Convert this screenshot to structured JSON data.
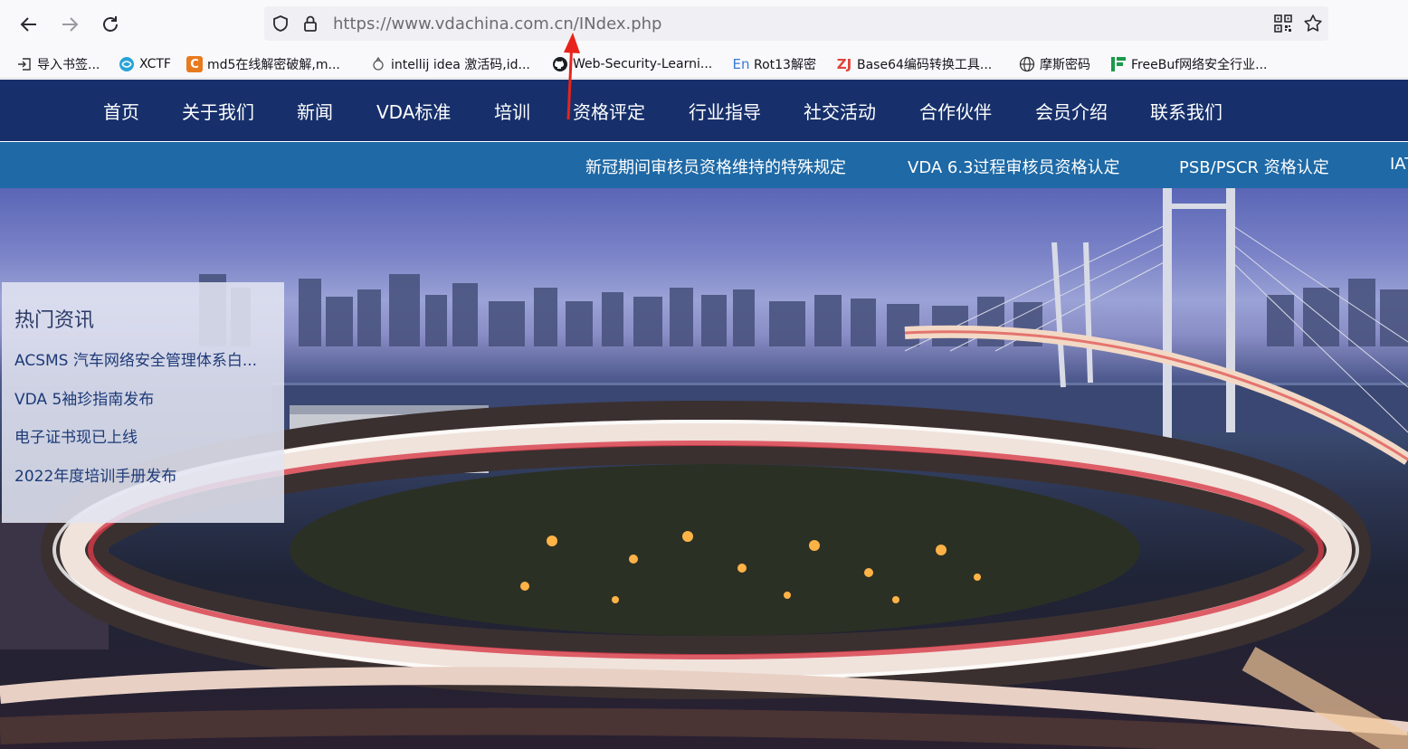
{
  "browser": {
    "url_main": "https://www.vdachina.com.cn/",
    "url_rest": "INdex.php",
    "bookmarks": [
      {
        "label": "导入书签...",
        "icon": "import-icon"
      },
      {
        "label": "XCTF",
        "icon": "xctf-icon"
      },
      {
        "label": "md5在线解密破解,m...",
        "icon": "cmd5-icon"
      },
      {
        "label": "intellij idea 激活码,id...",
        "icon": "idea-icon"
      },
      {
        "label": "Web-Security-Learni...",
        "icon": "github-icon"
      },
      {
        "label": "Rot13解密",
        "icon": "rot13-icon"
      },
      {
        "label": "Base64编码转换工具...",
        "icon": "base64-icon"
      },
      {
        "label": "摩斯密码",
        "icon": "globe-icon"
      },
      {
        "label": "FreeBuf网络安全行业...",
        "icon": "freebuf-icon"
      }
    ]
  },
  "nav": {
    "items": [
      "首页",
      "关于我们",
      "新闻",
      "VDA标准",
      "培训",
      "资格评定",
      "行业指导",
      "社交活动",
      "合作伙伴",
      "会员介绍",
      "联系我们"
    ]
  },
  "subnav": {
    "items": [
      "新冠期间审核员资格维持的特殊规定",
      "VDA 6.3过程审核员资格认定",
      "PSB/PSCR 资格认定",
      "IAT"
    ]
  },
  "hot": {
    "title": "热门资讯",
    "links": [
      "ACSMS 汽车网络安全管理体系白...",
      "VDA 5袖珍指南发布",
      "电子证书现已上线",
      "2022年度培训手册发布"
    ]
  },
  "colors": {
    "nav_bg": "#17306b",
    "subnav_bg": "#1e69a6",
    "annotation_arrow": "#e8231c"
  }
}
